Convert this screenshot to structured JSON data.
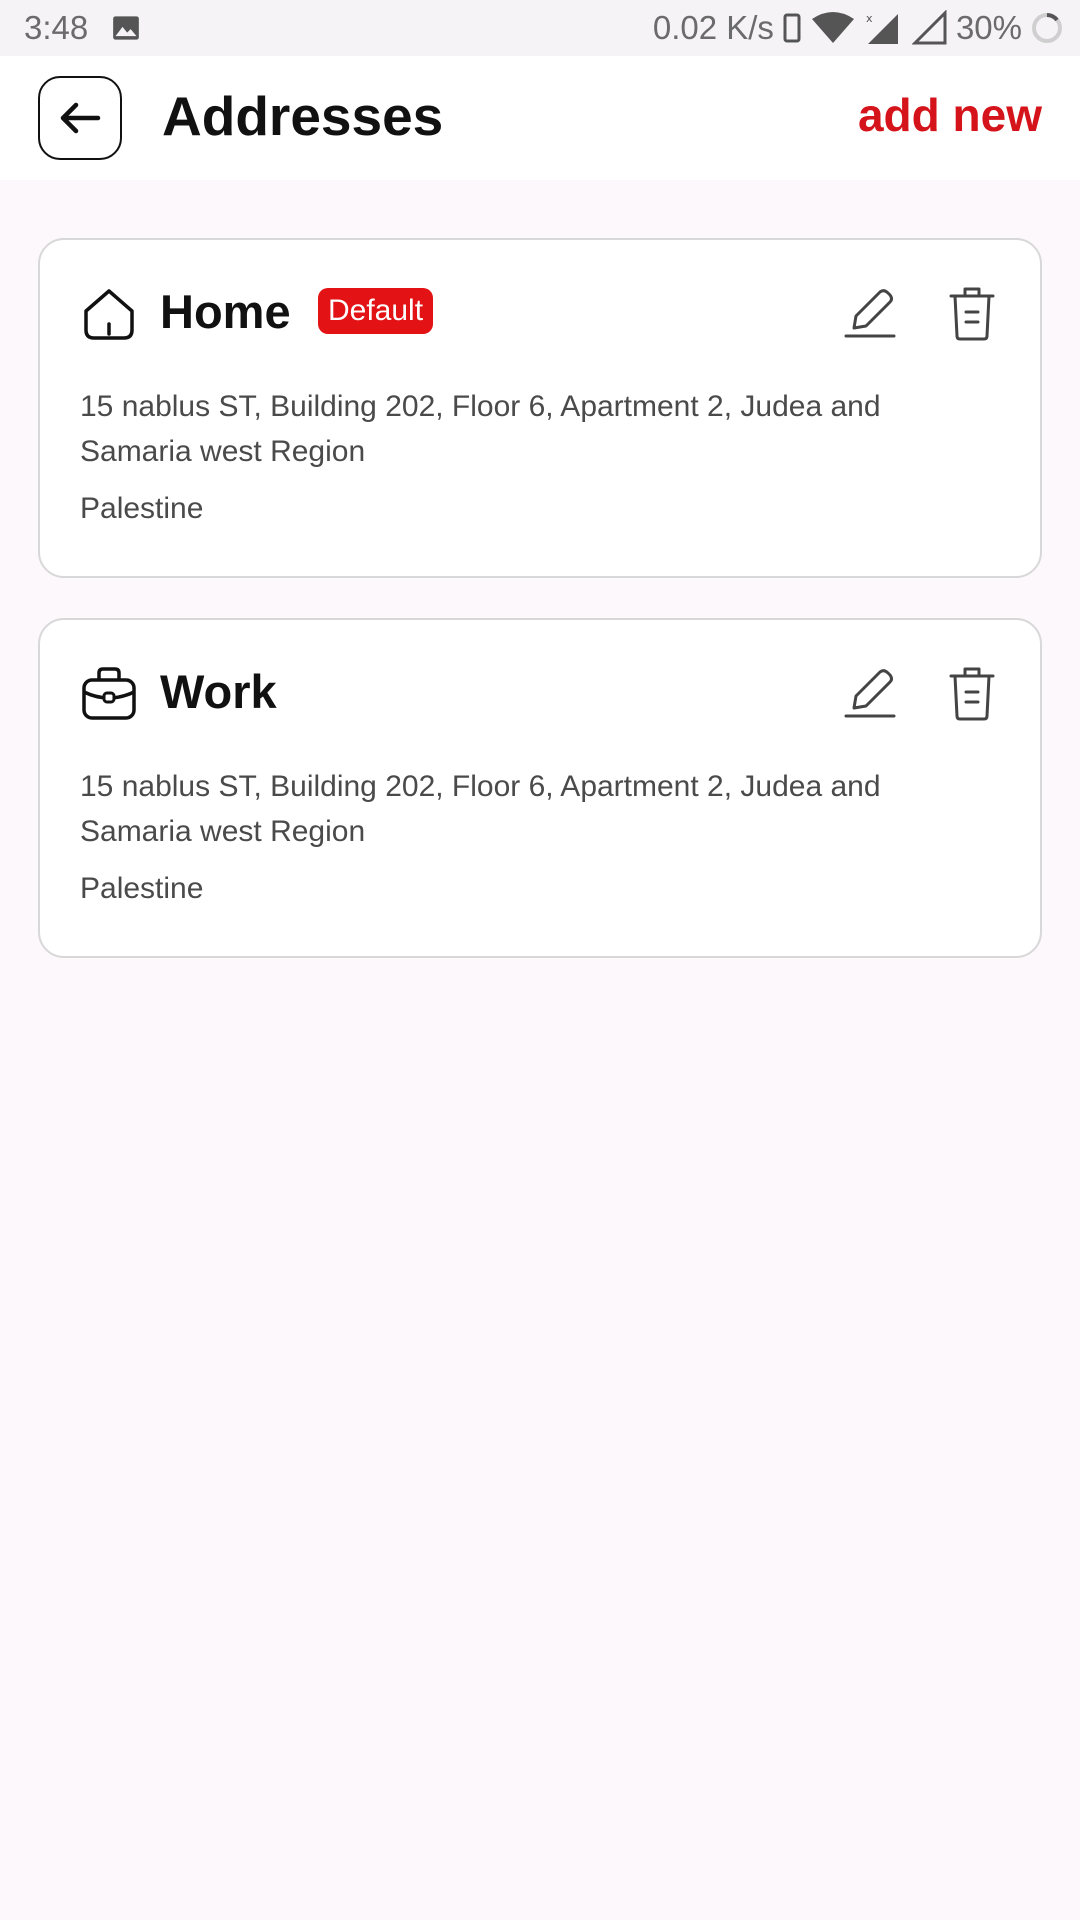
{
  "status_bar": {
    "time": "3:48",
    "network_speed": "0.02 K/s",
    "battery": "30%",
    "icons": [
      "gallery-icon",
      "phone-icon",
      "wifi-icon",
      "signal-icon",
      "signal-empty-icon",
      "battery-ring-icon"
    ]
  },
  "header": {
    "title": "Addresses",
    "add_new_label": "add new",
    "back_icon": "arrow-left-icon"
  },
  "addresses": [
    {
      "title": "Home",
      "icon": "home-icon",
      "badge": "Default",
      "address": "15 nablus ST, Building 202, Floor 6, Apartment 2, Judea and Samaria west Region",
      "country": "Palestine"
    },
    {
      "title": "Work",
      "icon": "briefcase-icon",
      "badge": "",
      "address": "15 nablus ST, Building 202, Floor 6, Apartment 2, Judea and Samaria west Region",
      "country": "Palestine"
    }
  ],
  "colors": {
    "accent": "#d4141a",
    "badge": "#e21215",
    "background": "#fdf8fc",
    "card_border": "#d8d8d8"
  }
}
